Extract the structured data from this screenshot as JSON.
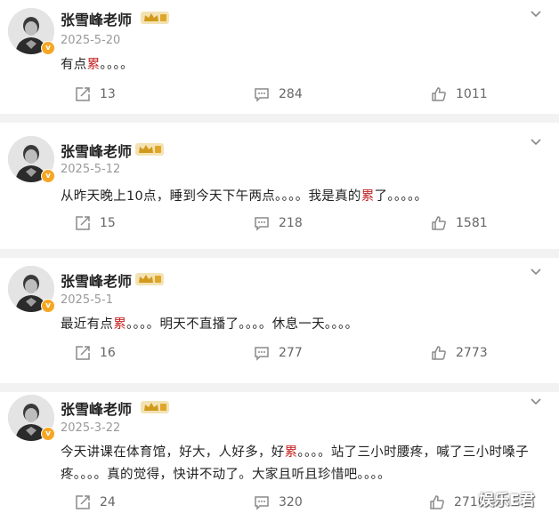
{
  "posts": [
    {
      "author": "张雪峰老师",
      "date": "2025-5-20",
      "content_before": "有点",
      "content_highlight": "累",
      "content_after": "。。。。",
      "reposts": "13",
      "comments": "284",
      "likes": "1011"
    },
    {
      "author": "张雪峰老师",
      "date": "2025-5-12",
      "content_before": "从昨天晚上10点，睡到今天下午两点。。。。我是真的",
      "content_highlight": "累",
      "content_after": "了。。。。。",
      "reposts": "15",
      "comments": "218",
      "likes": "1581"
    },
    {
      "author": "张雪峰老师",
      "date": "2025-5-1",
      "content_before": "最近有点",
      "content_highlight": "累",
      "content_after": "。。。。明天不直播了。。。。休息一天。。。。",
      "reposts": "16",
      "comments": "277",
      "likes": "2773"
    },
    {
      "author": "张雪峰老师",
      "date": "2025-3-22",
      "content_before": "今天讲课在体育馆，好大，人好多，好",
      "content_highlight": "累",
      "content_after": "。。。。站了三小时腰疼，喊了三小时嗓子疼。。。。真的觉得，快讲不动了。大家且听且珍惜吧。。。。",
      "reposts": "24",
      "comments": "320",
      "likes": "2710"
    }
  ],
  "watermark": "娱乐E君",
  "icons": {
    "repost": "repost-icon",
    "comment": "comment-icon",
    "like": "like-icon",
    "menu": "chevron-down-icon",
    "verified": "verified-badge-icon",
    "vip": "crown-icon"
  },
  "colors": {
    "highlight": "#c62828",
    "separator": "#f2f2f2",
    "verified": "#f5a623",
    "meta": "#999999"
  }
}
